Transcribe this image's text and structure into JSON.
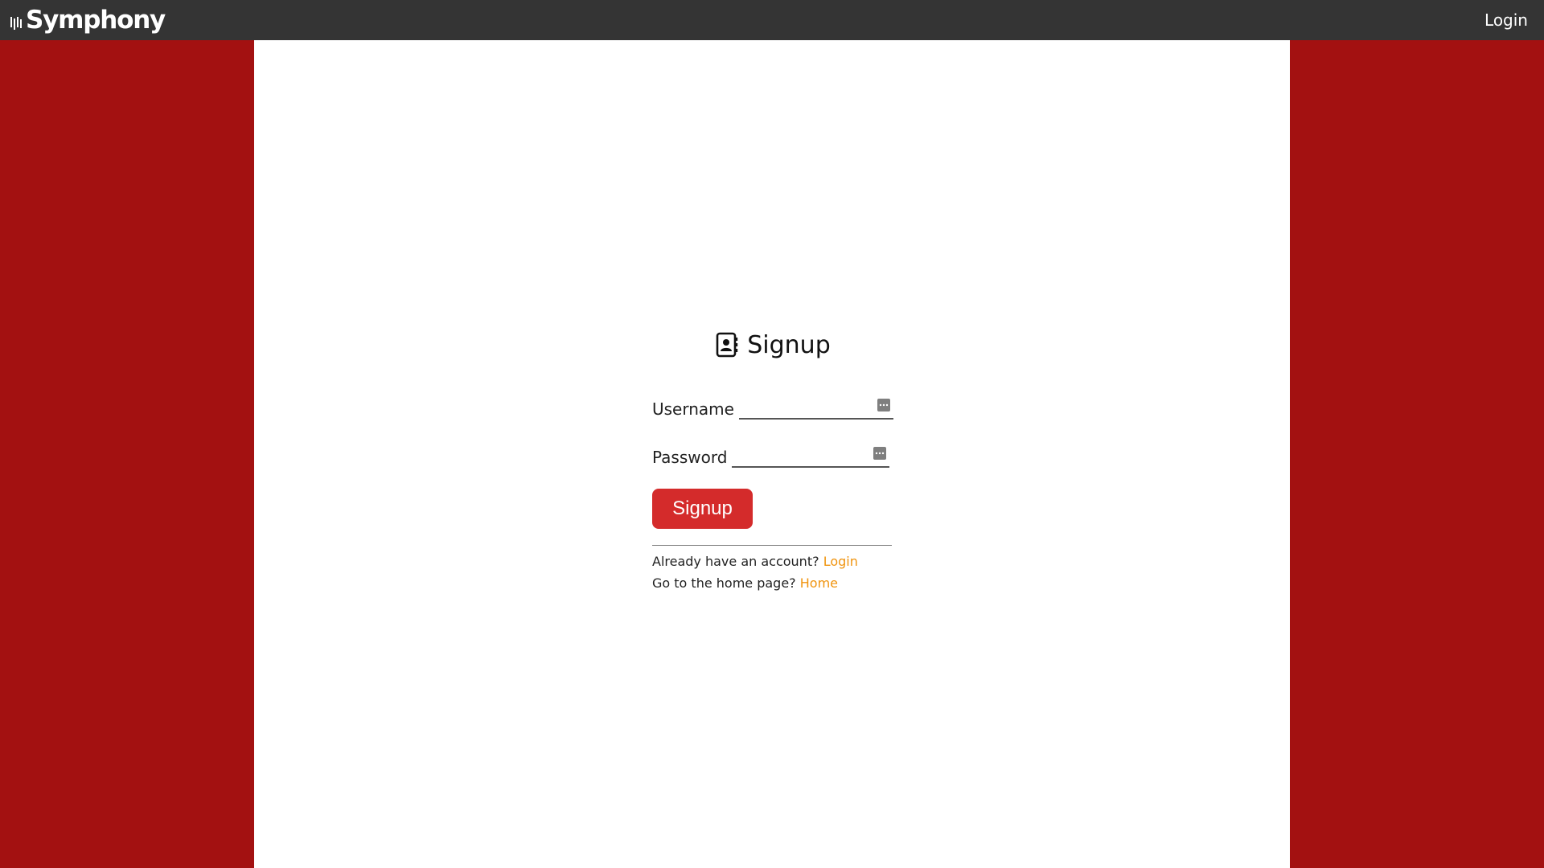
{
  "navbar": {
    "brand_text": "Symphony",
    "brand_icon": "equalizer-bars-icon",
    "login_label": "Login",
    "background": "#343434"
  },
  "page": {
    "side_color": "#a31111",
    "content_color": "#ffffff"
  },
  "form": {
    "title": "Signup",
    "title_icon": "contact-book-icon",
    "username_label": "Username",
    "username_value": "",
    "password_label": "Password",
    "password_value": "",
    "autofill_icon": "password-manager-icon",
    "submit_label": "Signup",
    "submit_color": "#d42b2b",
    "footer": {
      "account_prompt": "Already have an account?",
      "login_link": "Login",
      "home_prompt": "Go to the home page?",
      "home_link": "Home",
      "link_color": "#f0940f"
    }
  }
}
